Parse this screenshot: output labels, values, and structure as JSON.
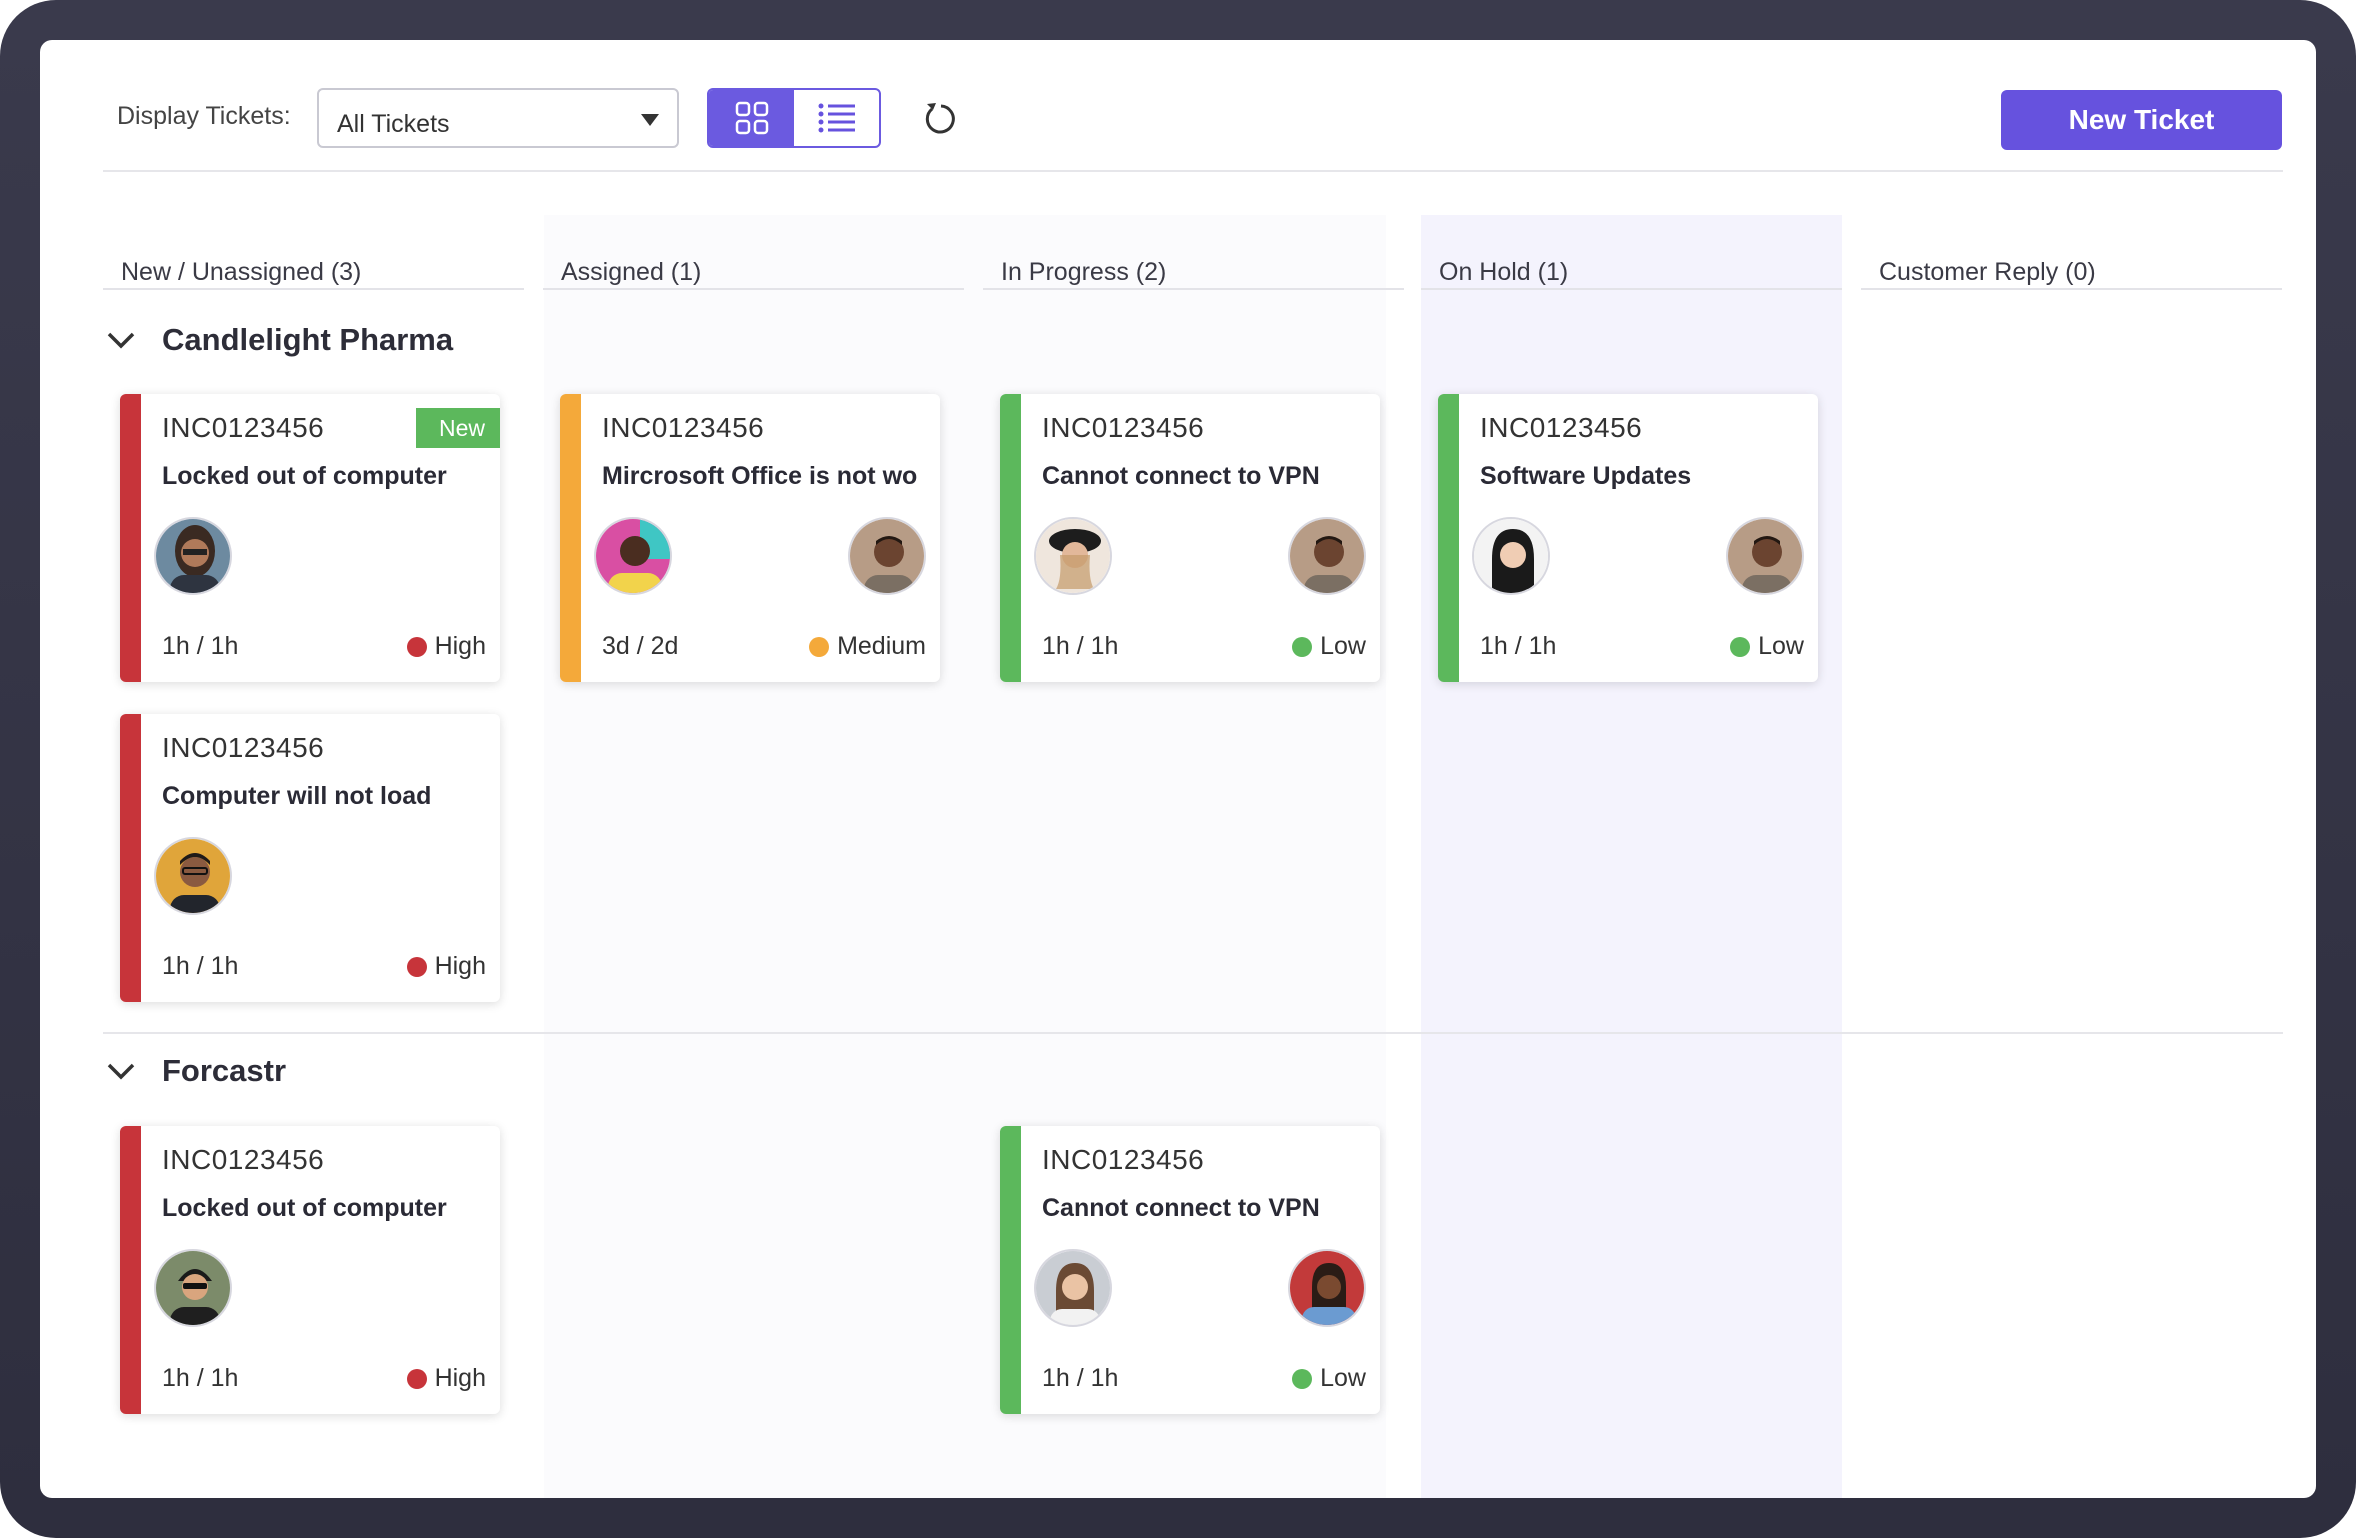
{
  "toolbar": {
    "display_label": "Display Tickets:",
    "filter_value": "All Tickets",
    "new_ticket_label": "New Ticket"
  },
  "columns": [
    {
      "label": "New / Unassigned (3)"
    },
    {
      "label": "Assigned (1)"
    },
    {
      "label": "In Progress (2)"
    },
    {
      "label": "On Hold (1)"
    },
    {
      "label": "Customer Reply (0)"
    }
  ],
  "groups": [
    {
      "name": "Candlelight Pharma"
    },
    {
      "name": "Forcastr"
    }
  ],
  "cards": [
    {
      "id": "INC0123456",
      "title": "Locked out of computer",
      "time": "1h / 1h",
      "priority": "High",
      "badge": "New"
    },
    {
      "id": "INC0123456",
      "title": "Computer will not load",
      "time": "1h / 1h",
      "priority": "High"
    },
    {
      "id": "INC0123456",
      "title": "Mircrosoft Office is not wo",
      "time": "3d / 2d",
      "priority": "Medium"
    },
    {
      "id": "INC0123456",
      "title": "Cannot connect to VPN",
      "time": "1h / 1h",
      "priority": "Low"
    },
    {
      "id": "INC0123456",
      "title": "Software Updates",
      "time": "1h / 1h",
      "priority": "Low"
    },
    {
      "id": "INC0123456",
      "title": "Locked out of computer",
      "time": "1h / 1h",
      "priority": "High"
    },
    {
      "id": "INC0123456",
      "title": "Cannot connect to VPN",
      "time": "1h / 1h",
      "priority": "Low"
    }
  ],
  "colors": {
    "accent": "#6652de",
    "high": "#c7343a",
    "medium": "#f4a93a",
    "low": "#5cb85c",
    "on_hold_bg": "#f4f3fd"
  },
  "icons": {
    "grid_view": "grid-icon",
    "list_view": "list-icon",
    "refresh": "refresh-icon",
    "dropdown": "caret-down-icon",
    "collapse": "chevron-down-icon"
  }
}
